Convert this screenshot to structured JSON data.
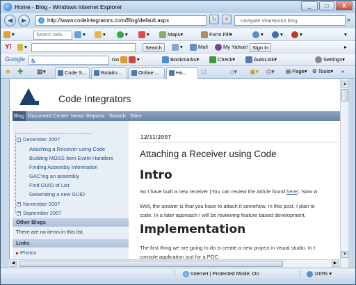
{
  "window": {
    "title": "Home - Blog - Windows Internet Explorer",
    "min": "_",
    "max": "□",
    "close": "X"
  },
  "address": {
    "url": "http://www.codeintegrators.com/Blog/default.aspx",
    "refresh": "↻",
    "stop": "✕",
    "search_text": "navigate sharepoint blog"
  },
  "toolbar1": {
    "search_placeholder": "Search web...",
    "maps": "Maps",
    "formfill": "Form Fill"
  },
  "toolbar2": {
    "search_btn": "Search",
    "mail": "Mail",
    "myyahoo": "My Yahoo!",
    "signin": "Sign In"
  },
  "toolbar3": {
    "google": "Google",
    "go": "Go",
    "bookmarks": "Bookmarks",
    "check": "Check",
    "autolink": "AutoLink",
    "settings": "Settings"
  },
  "tabs": [
    {
      "label": "Code S..."
    },
    {
      "label": "Rotatin..."
    },
    {
      "label": "Online ..."
    },
    {
      "label": "Ho..."
    }
  ],
  "commandbar": {
    "page": "Page",
    "tools": "Tools"
  },
  "site": {
    "name": "Code Integrators",
    "nav": [
      "Blog",
      "Document Center",
      "News",
      "Reports",
      "Search",
      "Sites"
    ]
  },
  "tree": {
    "month1": "December 2007",
    "posts": [
      "Attaching a Receiver using Code",
      "Building MOSS Item Event Handlers",
      "Finding Assembly Information",
      "GAC'ing an assembly",
      "Find GUID of List",
      "Generating a new GUID"
    ],
    "month2": "November 2007",
    "month3": "September 2007",
    "expand_minus": "−",
    "expand_plus": "+"
  },
  "sidebar": {
    "other_blogs": "Other Blogs",
    "other_blogs_text": "There are no items in this list.",
    "links": "Links",
    "photos": "Photos"
  },
  "post": {
    "date": "12/11/2007",
    "title": "Attaching a Receiver using Code",
    "h_intro": "Intro",
    "p1a": "So I have built a new receiver (You can review the article found ",
    "p1link": "here",
    "p1b": "). Now w",
    "p2": "Well, the answer is that you have to attach it somehow. In this post, I plan to",
    "p3": "code. In a later approach I will be reviewing feature based development.",
    "h_impl": "Implementation",
    "p4": "The first thing we are going to do is create a new project in visual studio. In t",
    "p5": "console application just for a POC:"
  },
  "status": {
    "zone": "Internet | Protected Mode: On",
    "zoom": "100%"
  }
}
